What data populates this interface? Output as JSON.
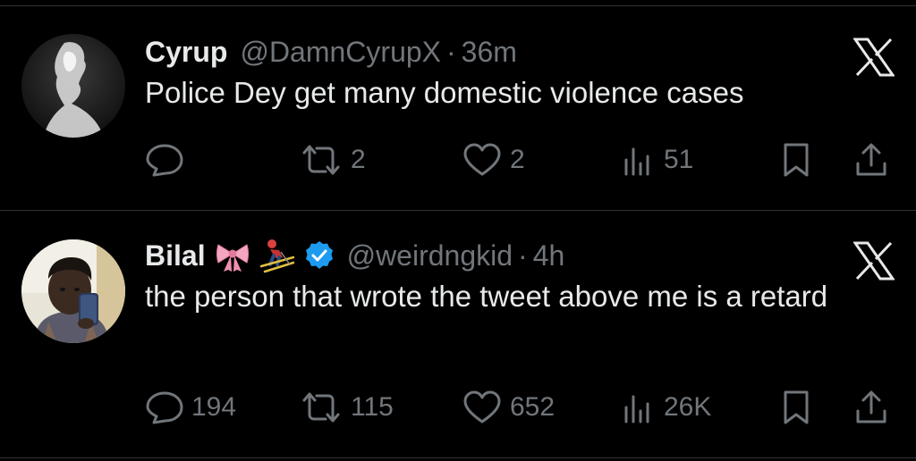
{
  "tweets": [
    {
      "name": "Cyrup",
      "handle": "@DamnCyrupX",
      "dot": "·",
      "time": "36m",
      "text": "Police Dey get many domestic violence cases",
      "replies": "",
      "retweets": "2",
      "likes": "2",
      "views": "51",
      "verified": false,
      "close_icon": "x-close-icon"
    },
    {
      "name": "Bilal",
      "emojis": [
        "🎀",
        "⛷"
      ],
      "handle": "@weirdngkid",
      "dot": "·",
      "time": "4h",
      "text": "the person that wrote the tweet above me is a retard",
      "replies": "194",
      "retweets": "115",
      "likes": "652",
      "views": "26K",
      "verified": true,
      "close_icon": "x-close-icon"
    }
  ],
  "colors": {
    "background": "#000000",
    "text": "#e7e9ea",
    "muted": "#71767b",
    "divider": "#2f3336",
    "verified": "#1d9bf0"
  }
}
